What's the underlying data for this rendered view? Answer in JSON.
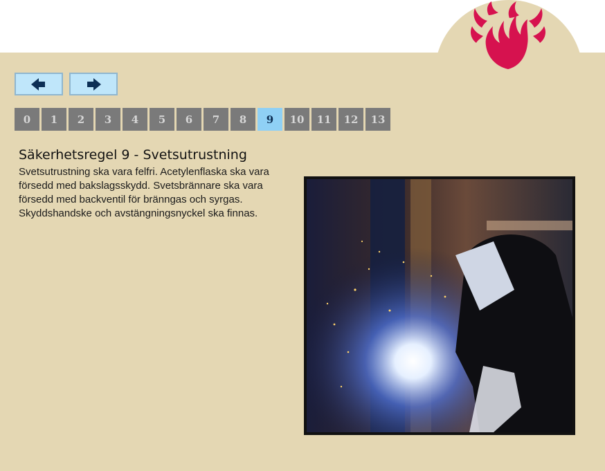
{
  "navigation": {
    "prev_icon": "arrow-left-icon",
    "next_icon": "arrow-right-icon"
  },
  "pages": [
    "0",
    "1",
    "2",
    "3",
    "4",
    "5",
    "6",
    "7",
    "8",
    "9",
    "10",
    "11",
    "12",
    "13"
  ],
  "active_page": "9",
  "content": {
    "title": "Säkerhetsregel 9 - Svetsutrustning",
    "lines": [
      "Svetsutrustning ska vara felfri. Acetylenflaska ska vara",
      "försedd med bakslagsskydd. Svetsbrännare ska vara",
      "försedd med backventil för bränngas och syrgas.",
      "Skyddshandske och avstängningsnyckel ska finnas."
    ]
  },
  "colors": {
    "panel": "#e4d7b3",
    "logo": "#d6124f",
    "nav_button": "#bfe6fa",
    "page_button": "#7a7a7a",
    "page_active": "#8fd0f5"
  }
}
